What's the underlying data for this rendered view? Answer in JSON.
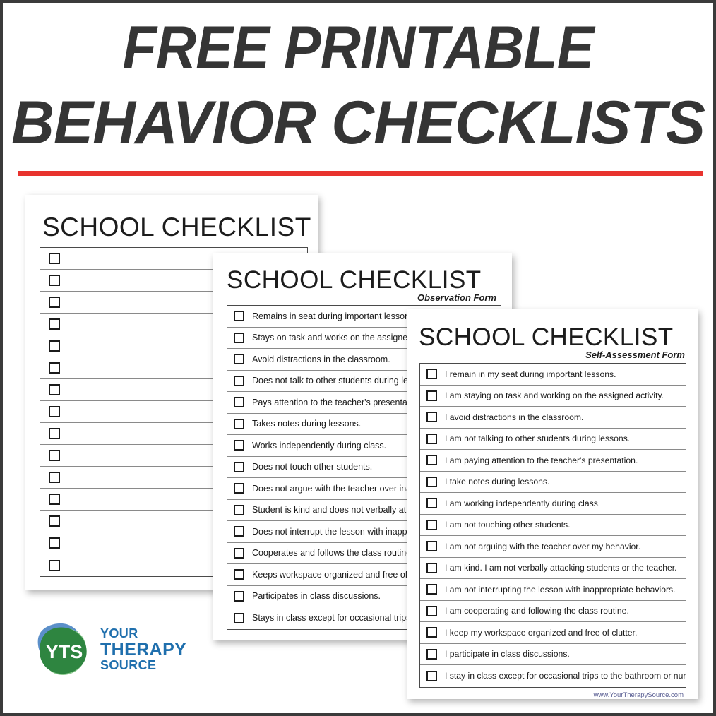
{
  "poster": {
    "headline_line1": "FREE PRINTABLE",
    "headline_line2": "BEHAVIOR CHECKLISTS",
    "accent_color": "#e8332e",
    "frame_color": "#3b3b3b",
    "text_color": "#353535"
  },
  "cards": {
    "back": {
      "title": "SCHOOL CHECKLIST",
      "subtitle": "",
      "footer": "",
      "items": [
        "",
        "",
        "",
        "",
        "",
        "",
        "",
        "",
        "",
        "",
        "",
        "",
        "",
        "",
        ""
      ]
    },
    "middle": {
      "title": "SCHOOL CHECKLIST",
      "subtitle": "Observation Form",
      "footer": "",
      "items": [
        "Remains in seat during important lessons.",
        "Stays on task and works on the assigned activity.",
        "Avoid distractions in the classroom.",
        "Does not talk to other students during lessons.",
        "Pays attention to the teacher's presentation.",
        "Takes notes during lessons.",
        "Works independently during class.",
        "Does not touch other students.",
        "Does not argue with the teacher over inappropriate behavior.",
        "Student is kind and does not verbally attack students or the teacher.",
        "Does not interrupt the lesson with inappropriate behaviors.",
        "Cooperates and follows the class routine.",
        "Keeps workspace organized and free of clutter.",
        "Participates in class discussions.",
        "Stays in class except for occasional trips to the bathroom or nurse."
      ]
    },
    "front": {
      "title": "SCHOOL CHECKLIST",
      "subtitle": "Self-Assessment Form",
      "footer": "www.YourTherapySource.com",
      "items": [
        "I remain in my seat during important lessons.",
        "I am staying on task and working on the assigned activity.",
        "I avoid distractions in the classroom.",
        "I am not talking to other students during lessons.",
        "I am paying attention to the teacher's presentation.",
        "I take notes during lessons.",
        "I am working independently during class.",
        "I am not touching other students.",
        "I am not arguing with the teacher over my behavior.",
        "I am kind. I am not verbally attacking students or the teacher.",
        "I am not interrupting the lesson with inappropriate behaviors.",
        "I am cooperating and following the class routine.",
        "I keep my workspace organized and free of clutter.",
        "I participate in class discussions.",
        "I stay in class except for occasional trips to the bathroom or nurse."
      ]
    }
  },
  "logo": {
    "monogram": "YTS",
    "line1": "YOUR",
    "line2": "THERAPY",
    "line3": "SOURCE",
    "colors": {
      "blue_petal": "#5b8fc9",
      "light_green_petal": "#8cc98f",
      "dark_green_petal": "#2e8540",
      "wordmark_blue": "#1f6fad"
    }
  }
}
